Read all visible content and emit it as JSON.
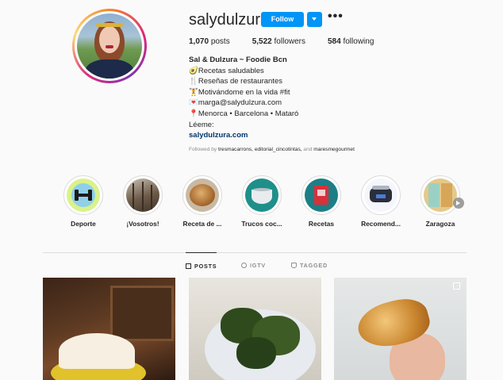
{
  "profile": {
    "username": "salydulzura",
    "follow_label": "Follow",
    "more_label": "•••",
    "stats": {
      "posts_count": "1,070",
      "posts_label": "posts",
      "followers_count": "5,522",
      "followers_label": "followers",
      "following_count": "584",
      "following_label": "following"
    },
    "bio": {
      "name": "Sal & Dulzura ~ Foodie Bcn",
      "line1": "🥑Recetas saludables",
      "line2": "🍴Reseñas de restaurantes",
      "line3": "🏋️Motivándome en la vida #fit",
      "line4": "💌marga@salydulzura.com",
      "line5": "📍Menorca • Barcelona • Mataró",
      "line6": "Léeme:",
      "link": "salydulzura.com"
    },
    "followed_by_prefix": "Followed by ",
    "followed_by_names": "tresmacarrons, editorial_cincotintas,",
    "followed_by_and": " and ",
    "followed_by_last": "maresmegourmet"
  },
  "highlights": [
    {
      "label": "Deporte",
      "icon": "dumbbell-icon"
    },
    {
      "label": "¡Vosotros!",
      "icon": "forest-icon"
    },
    {
      "label": "Receta de ...",
      "icon": "bread-icon"
    },
    {
      "label": "Trucos coc...",
      "icon": "bowl-icon"
    },
    {
      "label": "Recetas",
      "icon": "recipe-book-icon"
    },
    {
      "label": "Recomend...",
      "icon": "slow-cooker-icon"
    },
    {
      "label": "Zaragoza",
      "icon": "poster-icon"
    }
  ],
  "tabs": [
    {
      "label": "POSTS",
      "icon": "grid-icon",
      "active": true
    },
    {
      "label": "IGTV",
      "icon": "igtv-icon",
      "active": false
    },
    {
      "label": "TAGGED",
      "icon": "tag-icon",
      "active": false
    }
  ],
  "colors": {
    "accent": "#0095f6",
    "text": "#262626",
    "muted": "#8e8e8e",
    "link": "#00376b"
  }
}
